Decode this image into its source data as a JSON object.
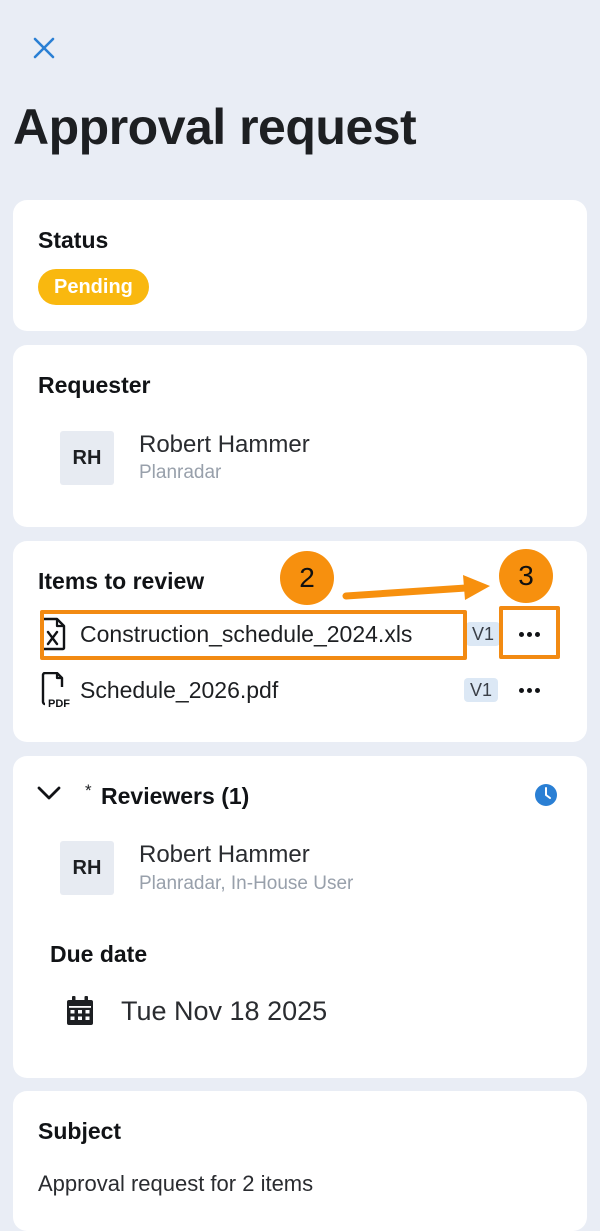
{
  "header": {
    "title": "Approval request"
  },
  "status": {
    "label": "Status",
    "value": "Pending",
    "color": "#f9b80f"
  },
  "requester": {
    "label": "Requester",
    "initials": "RH",
    "name": "Robert Hammer",
    "company": "Planradar"
  },
  "items": {
    "label": "Items to review",
    "files": [
      {
        "name": "Construction_schedule_2024.xls",
        "version": "V1",
        "icon": "excel-file-icon"
      },
      {
        "name": "Schedule_2026.pdf",
        "version": "V1",
        "icon": "pdf-file-icon"
      }
    ]
  },
  "reviewers": {
    "required_mark": "*",
    "label": "Reviewers (1)",
    "initials": "RH",
    "name": "Robert Hammer",
    "details": "Planradar, In-House User"
  },
  "due": {
    "label": "Due date",
    "value": "Tue Nov 18 2025"
  },
  "subject": {
    "label": "Subject",
    "value": "Approval request for 2 items"
  },
  "annotations": {
    "step_a": "2",
    "step_b": "3",
    "color": "#f28a12"
  },
  "colors": {
    "accent": "#2a7fd4",
    "background": "#e9edf5"
  }
}
